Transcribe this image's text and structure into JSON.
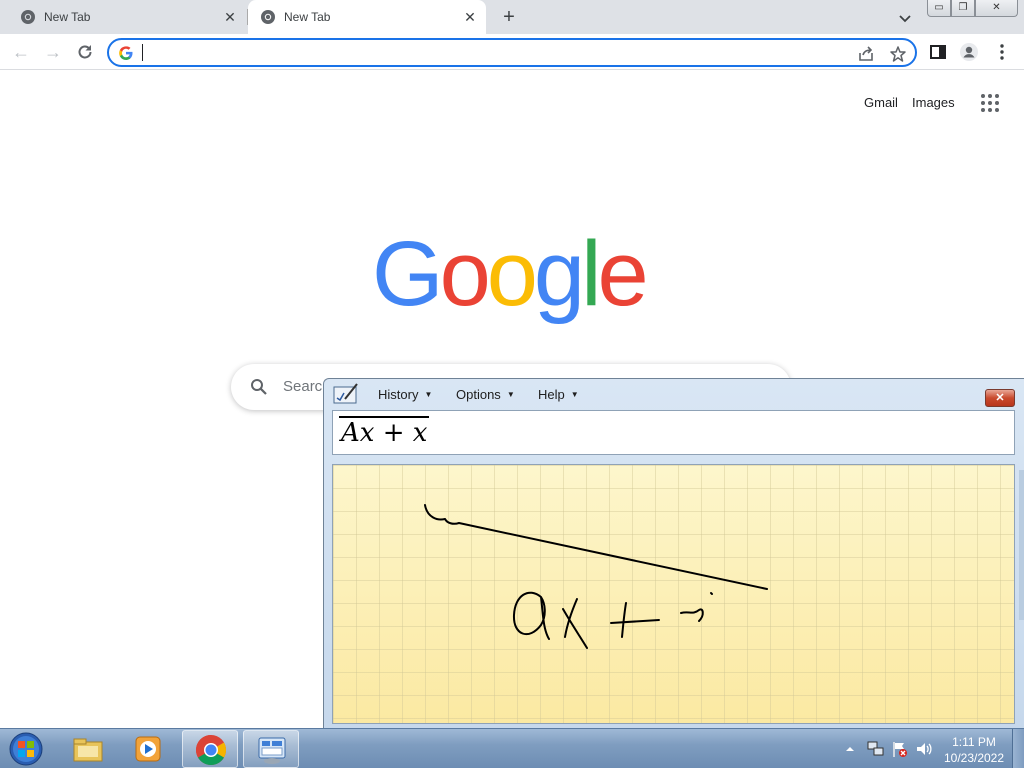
{
  "browser": {
    "tabs": [
      {
        "title": "New Tab",
        "active": false
      },
      {
        "title": "New Tab",
        "active": true
      }
    ],
    "omnibox": {
      "value": "",
      "placeholder": ""
    },
    "window_controls": {
      "minimize": "▭",
      "restore": "❐",
      "close": "✕"
    }
  },
  "page": {
    "links": {
      "gmail": "Gmail",
      "images": "Images"
    },
    "logo": {
      "letters": [
        {
          "char": "G",
          "color": "#4285F4"
        },
        {
          "char": "o",
          "color": "#EA4335"
        },
        {
          "char": "o",
          "color": "#FBBC05"
        },
        {
          "char": "g",
          "color": "#4285F4"
        },
        {
          "char": "l",
          "color": "#34A853"
        },
        {
          "char": "e",
          "color": "#EA4335"
        }
      ]
    },
    "search": {
      "placeholder_visible": "Searc"
    }
  },
  "math_input_panel": {
    "menus": {
      "history": "History",
      "options": "Options",
      "help": "Help"
    },
    "close_label": "✕",
    "preview_expression": "Ax + x",
    "ink_color": "#000000"
  },
  "taskbar": {
    "items": [
      {
        "icon": "file-explorer-icon",
        "open": false
      },
      {
        "icon": "media-player-icon",
        "open": false
      },
      {
        "icon": "chrome-icon",
        "open": true
      },
      {
        "icon": "math-input-panel-icon",
        "open": true
      }
    ],
    "clock": {
      "time": "1:11 PM",
      "date": "10/23/2022"
    }
  },
  "colors": {
    "accent": "#1a73e8",
    "panel_bg": "#c6d8ec",
    "writing_area": "#fff9cf"
  }
}
